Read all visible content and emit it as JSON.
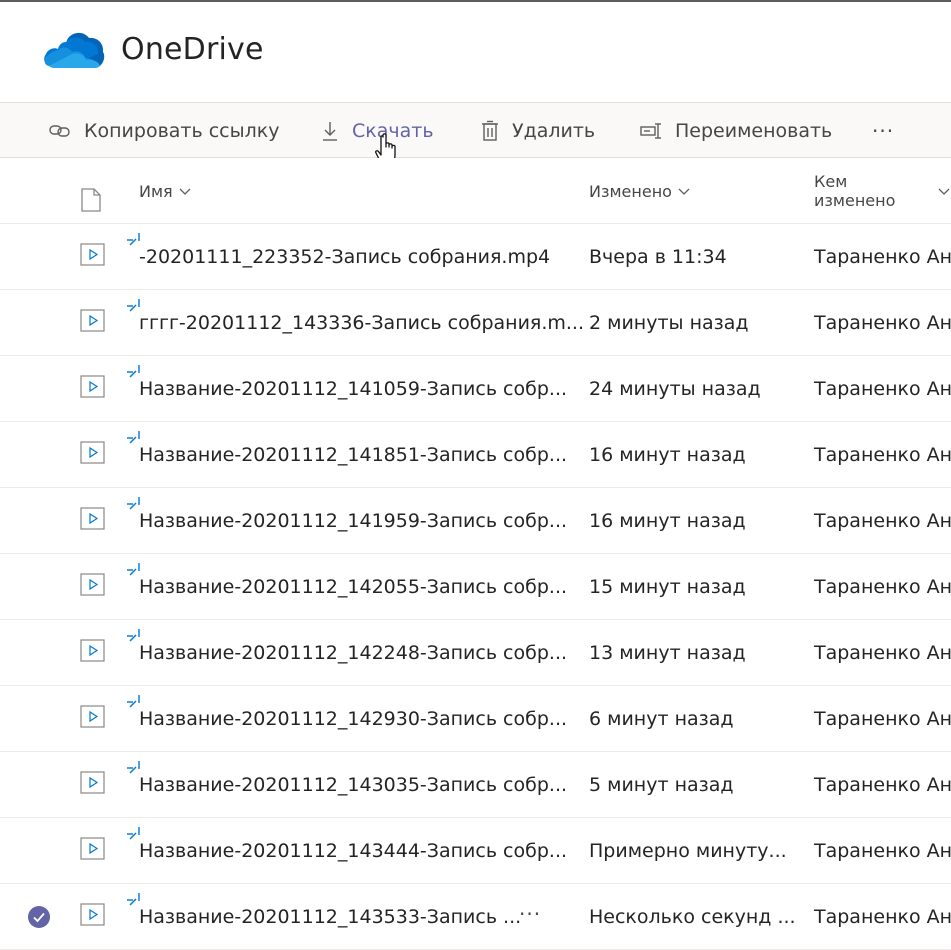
{
  "app": {
    "title": "OneDrive",
    "brand_color": "#0078d4"
  },
  "command_bar": {
    "copy_link": "Копировать ссылку",
    "download": "Скачать",
    "delete": "Удалить",
    "rename": "Переименовать",
    "more": "···",
    "hover_color": "#6264a7"
  },
  "columns": {
    "name": "Имя",
    "modified": "Изменено",
    "modified_by": "Кем изменено"
  },
  "rows": [
    {
      "name": "-20201111_223352-Запись собрания.mp4",
      "modified": "Вчера в 11:34",
      "modified_by": "Тараненко Анд",
      "selected": false
    },
    {
      "name": "гггг-20201112_143336-Запись собрания.m...",
      "modified": "2 минуты назад",
      "modified_by": "Тараненко Анд",
      "selected": false
    },
    {
      "name": "Название-20201112_141059-Запись собр...",
      "modified": "24 минуты назад",
      "modified_by": "Тараненко Анд",
      "selected": false
    },
    {
      "name": "Название-20201112_141851-Запись собр...",
      "modified": "16 минут назад",
      "modified_by": "Тараненко Анд",
      "selected": false
    },
    {
      "name": "Название-20201112_141959-Запись собр...",
      "modified": "16 минут назад",
      "modified_by": "Тараненко Анд",
      "selected": false
    },
    {
      "name": "Название-20201112_142055-Запись собр...",
      "modified": "15 минут назад",
      "modified_by": "Тараненко Анд",
      "selected": false
    },
    {
      "name": "Название-20201112_142248-Запись собр...",
      "modified": "13 минут назад",
      "modified_by": "Тараненко Анд",
      "selected": false
    },
    {
      "name": "Название-20201112_142930-Запись собр...",
      "modified": "6 минут назад",
      "modified_by": "Тараненко Анд",
      "selected": false
    },
    {
      "name": "Название-20201112_143035-Запись собр...",
      "modified": "5 минут назад",
      "modified_by": "Тараненко Анд",
      "selected": false
    },
    {
      "name": "Название-20201112_143444-Запись собр...",
      "modified": "Примерно минуту...",
      "modified_by": "Тараненко Анд",
      "selected": false
    },
    {
      "name": "Название-20201112_143533-Запись ...",
      "modified": "Несколько секунд ...",
      "modified_by": "Тараненко Анд",
      "selected": true,
      "more": "···"
    }
  ],
  "accent": "#6264a7"
}
